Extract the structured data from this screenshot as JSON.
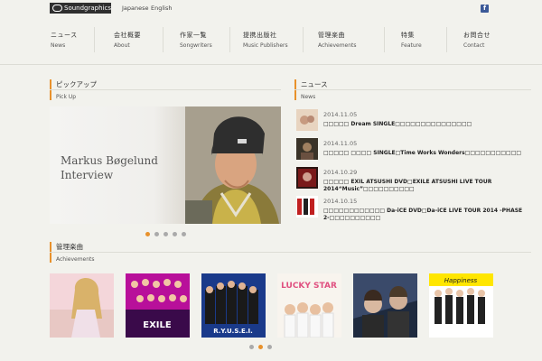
{
  "header": {
    "logo_text": "Soundgraphics",
    "lang_jp": "Japanese",
    "lang_en": "English",
    "facebook": "f"
  },
  "nav": [
    {
      "jp": "ニュース",
      "en": "News"
    },
    {
      "jp": "会社概要",
      "en": "About"
    },
    {
      "jp": "作家一覧",
      "en": "Songwriters"
    },
    {
      "jp": "提携出版社",
      "en": "Music Publishers"
    },
    {
      "jp": "管理楽曲",
      "en": "Achievements"
    },
    {
      "jp": "特集",
      "en": "Feature"
    },
    {
      "jp": "お問合せ",
      "en": "Contact"
    }
  ],
  "pickup": {
    "title_jp": "ピックアップ",
    "title_en": "Pick Up",
    "slide_title_line1": "Markus Bøgelund",
    "slide_title_line2": "Interview"
  },
  "news": {
    "title_jp": "ニュース",
    "title_en": "News",
    "items": [
      {
        "date": "2014.11.05",
        "text": "□□□□□ Dream SINGLE□□□□□□□□□□□□□□□"
      },
      {
        "date": "2014.11.05",
        "text": "□□□□□ □□□□ SINGLE□Time Works Wonders□□□□□□□□□□□"
      },
      {
        "date": "2014.10.29",
        "text": "□□□□□ EXIL ATSUSHI DVD□EXILE ATSUSHI LIVE TOUR"
      },
      {
        "date": "2014.10.15",
        "text": "□□□□□□□□□□□□ Da-iCE DVD□Da-iCE LIVE TOUR 2014 -PHASE"
      }
    ],
    "items_line2": [
      "",
      "",
      "2014“Music”□□□□□□□□□□",
      "2-□□□□□□□□□□"
    ]
  },
  "achievements": {
    "title_jp": "管理楽曲",
    "title_en": "Achievements",
    "albums": [
      {
        "name": "album-1",
        "label": ""
      },
      {
        "name": "album-2",
        "label": "EXILE"
      },
      {
        "name": "album-3",
        "label": "R.Y.U.S.E.I."
      },
      {
        "name": "album-4",
        "label": "LUCKY STAR"
      },
      {
        "name": "album-5",
        "label": ""
      },
      {
        "name": "album-6",
        "label": "Happiness"
      }
    ]
  },
  "colors": {
    "accent": "#e8912b",
    "background": "#f2f2ed",
    "facebook": "#3b5998"
  }
}
